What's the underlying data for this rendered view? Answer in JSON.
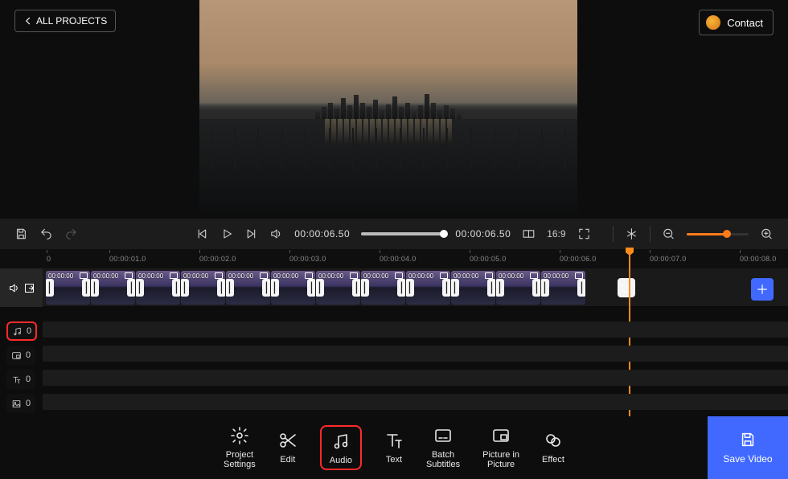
{
  "header": {
    "all_projects": "ALL PROJECTS",
    "contact": "Contact"
  },
  "controls": {
    "time_current": "00:00:06.50",
    "time_total": "00:00:06.50",
    "aspect_ratio": "16:9"
  },
  "ruler": {
    "marks": [
      "0",
      "00:00:01.0",
      "00:00:02.0",
      "00:00:03.0",
      "00:00:04.0",
      "00:00:05.0",
      "00:00:06.0",
      "00:00:07.0",
      "00:00:08.0"
    ]
  },
  "clips": {
    "ts": "00:00:00"
  },
  "tracks": {
    "audio_count": "0",
    "pip_count": "0",
    "text_count": "0",
    "effect_count": "0"
  },
  "tools": {
    "project_settings": "Project\nSettings",
    "edit": "Edit",
    "audio": "Audio",
    "text": "Text",
    "batch_subtitles": "Batch\nSubtitles",
    "pip": "Picture in\nPicture",
    "effect": "Effect",
    "save_video": "Save Video"
  }
}
